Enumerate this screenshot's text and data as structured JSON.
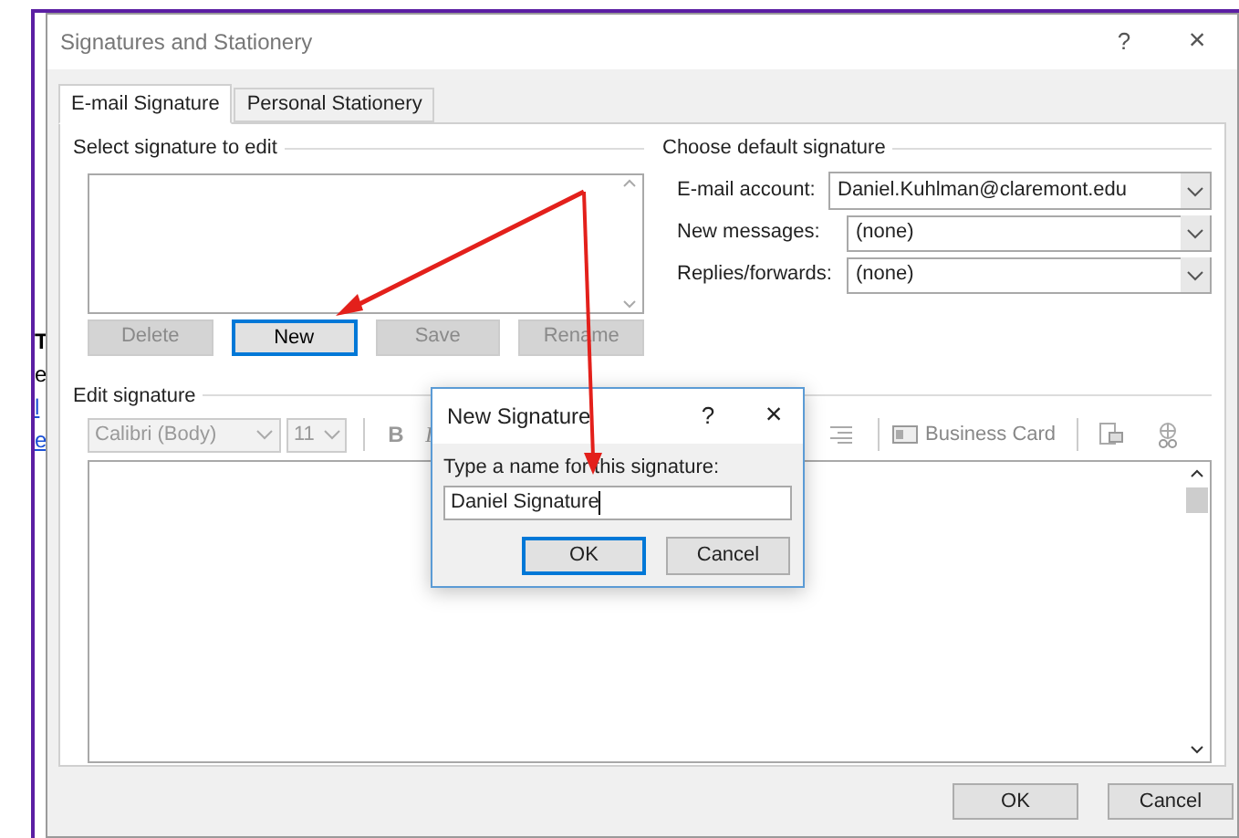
{
  "background_fragments": [
    {
      "text": "T",
      "kind": "bold"
    },
    {
      "text": "e",
      "kind": "plain"
    },
    {
      "text": "l",
      "kind": "link"
    },
    {
      "text": "e",
      "kind": "link"
    }
  ],
  "window": {
    "title": "Signatures and Stationery",
    "help": "?",
    "close": "×"
  },
  "tabs": [
    {
      "label": "E-mail Signature",
      "selected": true
    },
    {
      "label": "Personal Stationery",
      "selected": false
    }
  ],
  "select_signature": {
    "heading": "Select signature to edit",
    "buttons": [
      {
        "label": "Delete",
        "disabled": true,
        "focused": false
      },
      {
        "label": "New",
        "disabled": false,
        "focused": true
      },
      {
        "label": "Save",
        "disabled": true,
        "focused": false
      },
      {
        "label": "Rename",
        "disabled": true,
        "focused": false
      }
    ]
  },
  "default_signature": {
    "heading": "Choose default signature",
    "fields": [
      {
        "label": "E-mail account:",
        "value": "Daniel.Kuhlman@claremont.edu"
      },
      {
        "label": "New messages:",
        "value": "(none)"
      },
      {
        "label": "Replies/forwards:",
        "value": "(none)"
      }
    ]
  },
  "edit_signature": {
    "heading": "Edit signature",
    "font": "Calibri (Body)",
    "size": "11",
    "bold": "B",
    "italic": "I",
    "business_card": "Business Card"
  },
  "dialog": {
    "title": "New Signature",
    "help": "?",
    "close": "×",
    "prompt": "Type a name for this signature:",
    "value": "Daniel Signature",
    "buttons": [
      {
        "label": "OK",
        "focused": true
      },
      {
        "label": "Cancel",
        "focused": false
      }
    ]
  },
  "footer_buttons": [
    "OK",
    "Cancel"
  ]
}
